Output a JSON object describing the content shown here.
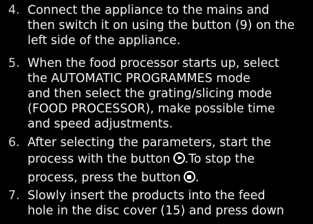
{
  "steps": [
    {
      "number": "4.",
      "lines": [
        "Connect the appliance to the mains and",
        "then switch it on using the button (9) on the",
        "left side of the appliance."
      ]
    },
    {
      "number": "5.",
      "lines": [
        "When the food processor starts up, select",
        "the AUTOMATIC PROGRAMMES mode",
        "and then select the grating/slicing mode",
        "(FOOD PROCESSOR), make possible time",
        "and speed adjustments."
      ]
    },
    {
      "number": "6.",
      "line1": "After selecting the parameters, start the",
      "line2_before": "process with the button",
      "line2_after": ".To stop the",
      "line3_before": "process, press the button",
      "line3_after": ".",
      "start_icon": "play-circle-icon",
      "stop_icon": "stop-circle-icon"
    },
    {
      "number": "7.",
      "lines": [
        "Slowly insert the products into the feed",
        "hole in the disc cover (15) and press down"
      ]
    }
  ],
  "colors": {
    "background": "#000000",
    "text": "#f2f2f2",
    "numbers": "#d8d8d8"
  }
}
